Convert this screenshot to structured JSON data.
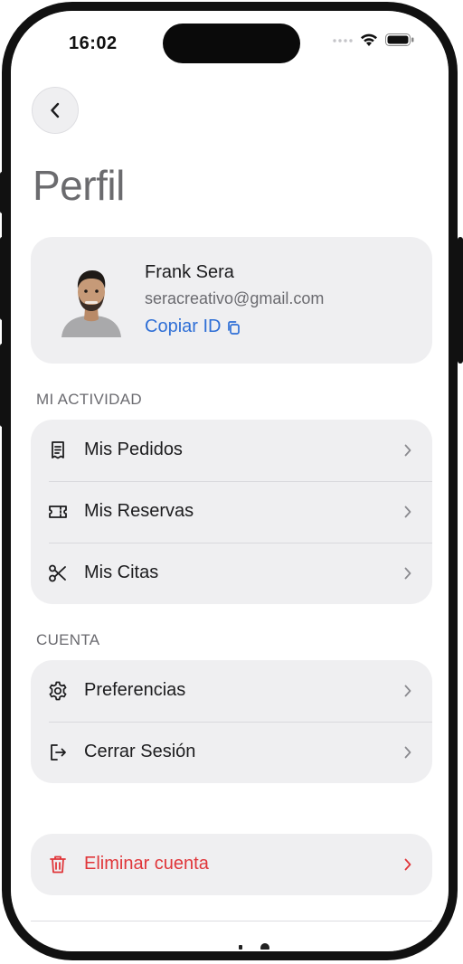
{
  "status_bar": {
    "time": "16:02"
  },
  "header": {
    "title": "Perfil"
  },
  "profile": {
    "name": "Frank Sera",
    "email": "seracreativo@gmail.com",
    "copy_id_label": "Copiar ID"
  },
  "sections": {
    "activity": {
      "label": "MI ACTIVIDAD",
      "items": [
        {
          "label": "Mis Pedidos",
          "icon": "receipt-icon"
        },
        {
          "label": "Mis Reservas",
          "icon": "ticket-icon"
        },
        {
          "label": "Mis Citas",
          "icon": "scissors-icon"
        }
      ]
    },
    "account": {
      "label": "CUENTA",
      "items": [
        {
          "label": "Preferencias",
          "icon": "gear-icon"
        },
        {
          "label": "Cerrar Sesión",
          "icon": "logout-icon"
        }
      ]
    }
  },
  "danger": {
    "delete_label": "Eliminar cuenta",
    "icon": "trash-icon"
  },
  "colors": {
    "accent_link": "#2f6fd6",
    "danger": "#e0363a",
    "card_bg": "#efeff1"
  }
}
